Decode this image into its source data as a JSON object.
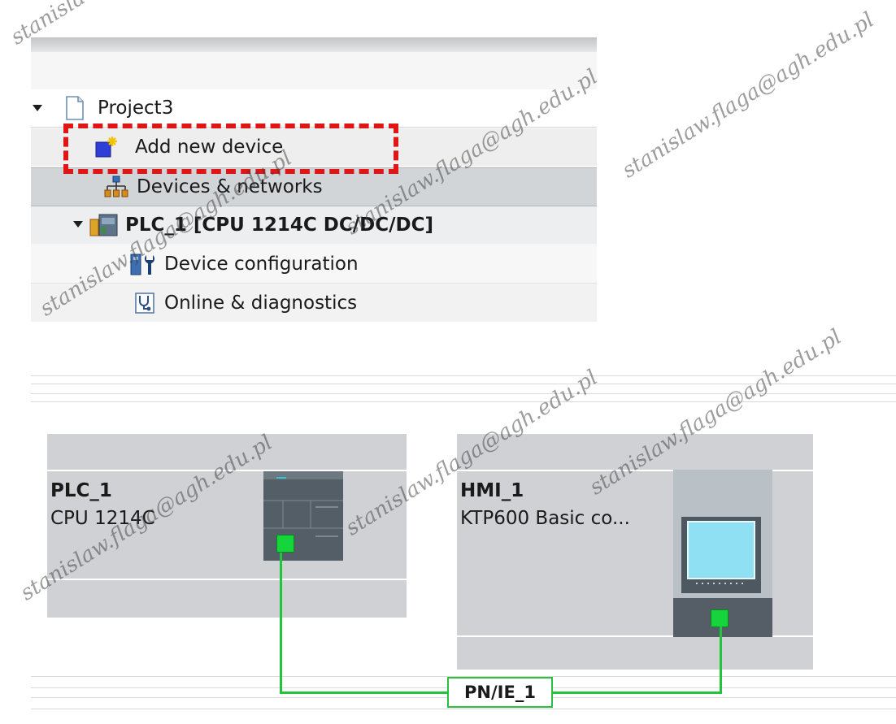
{
  "tree": {
    "project": "Project3",
    "add_device": "Add new device",
    "devices_networks": "Devices & networks",
    "plc_node": "PLC_1 [CPU 1214C DC/DC/DC]",
    "device_config": "Device configuration",
    "online_diag": "Online & diagnostics"
  },
  "network": {
    "plc": {
      "name": "PLC_1",
      "model": "CPU 1214C"
    },
    "hmi": {
      "name": "HMI_1",
      "model": "KTP600 Basic co..."
    },
    "subnet": "PN/IE_1"
  },
  "watermarks": [
    "stanislaw.flaga@agh.edu.pl",
    "stanislaw.flaga@agh.edu.pl",
    "stanislaw.flaga@agh.edu.pl",
    "stanislaw.flaga@agh.edu.pl",
    "stanislaw.flaga@agh.edu.pl",
    "stanislaw.flaga@agh.edu.pl",
    "stanislaw.flaga@agh.edu.pl"
  ],
  "colors": {
    "selection_dash": "#e01515",
    "ethernet": "#22c43c",
    "port": "#16d43c"
  }
}
